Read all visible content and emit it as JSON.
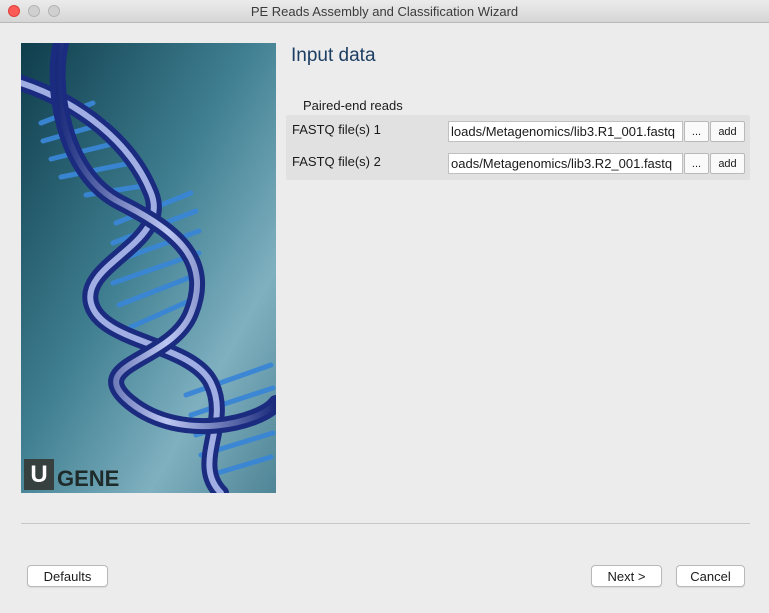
{
  "window": {
    "title": "PE Reads Assembly and Classification Wizard"
  },
  "logo": {
    "letter": "U",
    "word": "GENE"
  },
  "page": {
    "title": "Input data"
  },
  "paired_end": {
    "group_label": "Paired-end reads",
    "rows": [
      {
        "label": "FASTQ file(s) 1",
        "value": "loads/Metagenomics/lib3.R1_001.fastq",
        "browse_label": "...",
        "add_label": "add"
      },
      {
        "label": "FASTQ file(s) 2",
        "value": "oads/Metagenomics/lib3.R2_001.fastq",
        "browse_label": "...",
        "add_label": "add"
      }
    ]
  },
  "buttons": {
    "defaults": "Defaults",
    "next": "Next >",
    "cancel": "Cancel"
  },
  "colors": {
    "close_button": "#fc5b57",
    "page_title": "#1d3e63",
    "dna_blue": "#2a67c4"
  }
}
